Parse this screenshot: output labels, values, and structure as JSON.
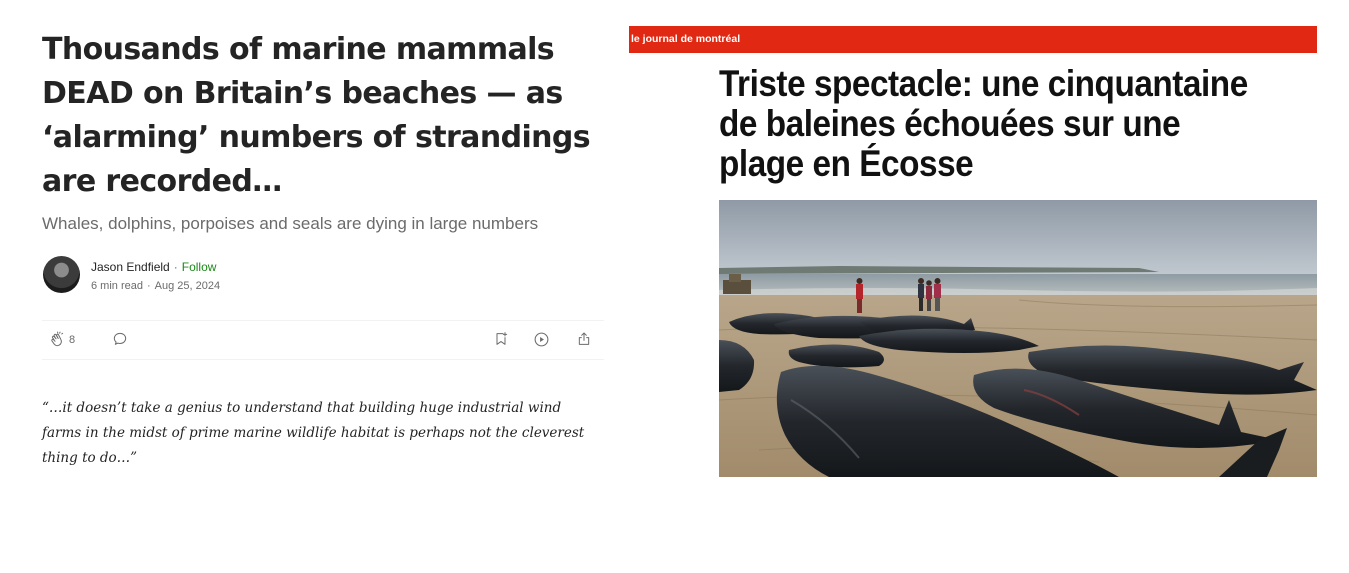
{
  "article": {
    "headline": "Thousands of marine mammals DEAD on Britain’s beaches — as ‘alarming’ numbers of strandings are recorded…",
    "subtitle": "Whales, dolphins, porpoises and seals are dying in large numbers",
    "author": {
      "name": "Jason Endfield",
      "follow_label": "Follow",
      "separator": "·",
      "read_time": "6 min read",
      "date": "Aug 25, 2024"
    },
    "actions": {
      "clap_count": "8",
      "icons": [
        "clap-icon",
        "comment-icon",
        "bookmark-icon",
        "play-icon",
        "share-icon"
      ]
    },
    "quote": "“…it doesn’t take a genius to understand that building huge industrial wind farms in the midst of prime marine wildlife habitat is perhaps not the cleverest thing to do…”"
  },
  "journal": {
    "brand": "le journal de montréal",
    "brand_color": "#e02812",
    "headline": "Triste spectacle: une cinquantaine de baleines échouées sur une plage en Écosse"
  },
  "colors": {
    "medium_green": "#1a8917",
    "muted_text": "#6b6b6b",
    "body_text": "#242424"
  }
}
